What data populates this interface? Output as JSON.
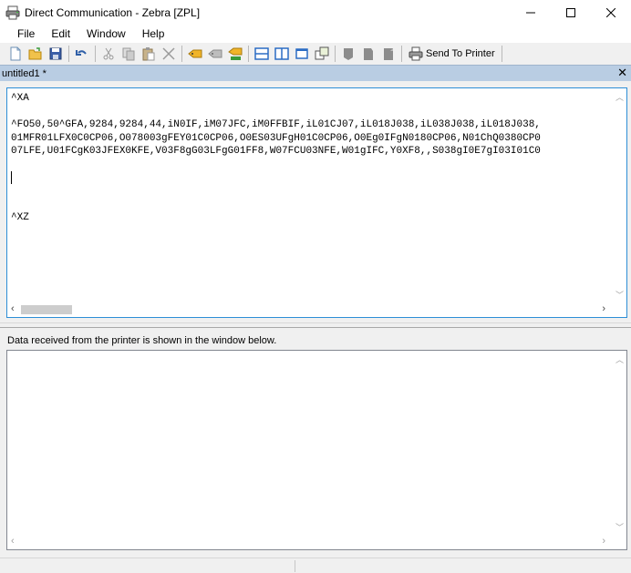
{
  "window": {
    "title": "Direct Communication - Zebra [ZPL]",
    "controls": [
      "minimize-icon",
      "maximize-icon",
      "close-icon"
    ]
  },
  "menu": {
    "items": [
      "File",
      "Edit",
      "Window",
      "Help"
    ]
  },
  "toolbar": {
    "send_label": "Send To Printer"
  },
  "doc_tab": {
    "name": "untitled1 *"
  },
  "editor": {
    "lines": [
      "^XA",
      "",
      "^FO50,50^GFA,9284,9284,44,iN0IF,iM07JFC,iM0FFBIF,iL01CJ07,iL018J038,iL038J038,iL018J038,",
      "01MFR01LFX0C0CP06,O078003gFEY01C0CP06,O0ES03UFgH01C0CP06,O0Eg0IFgN0180CP06,N01ChQ0380CP0",
      "07LFE,U01FCgK03JFEX0KFE,V03F8gG03LFgG01FF8,W07FCU03NFE,W01gIFC,Y0XF8,,S038gI0E7gI03I01C0",
      "",
      "",
      "",
      "",
      "^XZ"
    ]
  },
  "output": {
    "label": "Data received from the printer is shown in the window below."
  }
}
